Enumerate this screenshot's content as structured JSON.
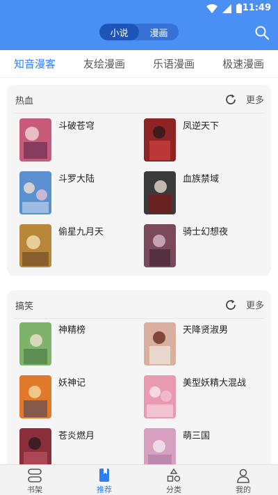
{
  "status": {
    "time": "11:49"
  },
  "header": {
    "segments": [
      {
        "label": "小说"
      },
      {
        "label": "漫画"
      }
    ],
    "active_segment": 0
  },
  "tabs": [
    {
      "label": "知音漫客",
      "active": true
    },
    {
      "label": "友绘漫画",
      "active": false
    },
    {
      "label": "乐语漫画",
      "active": false
    },
    {
      "label": "极速漫画",
      "active": false
    }
  ],
  "sections": [
    {
      "title": "热血",
      "more": "更多",
      "items": [
        {
          "title": "斗破苍穹",
          "color": "#c85a7a"
        },
        {
          "title": "凤逆天下",
          "color": "#8e2424"
        },
        {
          "title": "斗罗大陆",
          "color": "#5a8fd0"
        },
        {
          "title": "血族禁域",
          "color": "#3a3a3a"
        },
        {
          "title": "偷星九月天",
          "color": "#b8873a"
        },
        {
          "title": "骑士幻想夜",
          "color": "#7a4a5a"
        }
      ]
    },
    {
      "title": "搞笑",
      "more": "更多",
      "items": [
        {
          "title": "神精榜",
          "color": "#7fb26a"
        },
        {
          "title": "天降贤淑男",
          "color": "#d9b0a0"
        },
        {
          "title": "妖神记",
          "color": "#e07a2a"
        },
        {
          "title": "美型妖精大混战",
          "color": "#e89ab0"
        },
        {
          "title": "苍炎燃月",
          "color": "#8a2e3a"
        },
        {
          "title": "萌三国",
          "color": "#d8a0c0"
        }
      ]
    }
  ],
  "bottom_nav": [
    {
      "label": "书架",
      "icon": "bookshelf-icon",
      "active": false
    },
    {
      "label": "推荐",
      "icon": "bookmark-icon",
      "active": true
    },
    {
      "label": "分类",
      "icon": "category-shapes-icon",
      "active": false
    },
    {
      "label": "我的",
      "icon": "profile-icon",
      "active": false
    }
  ],
  "colors": {
    "primary": "#4a8ff3",
    "tab_active": "#2f7ff3"
  }
}
